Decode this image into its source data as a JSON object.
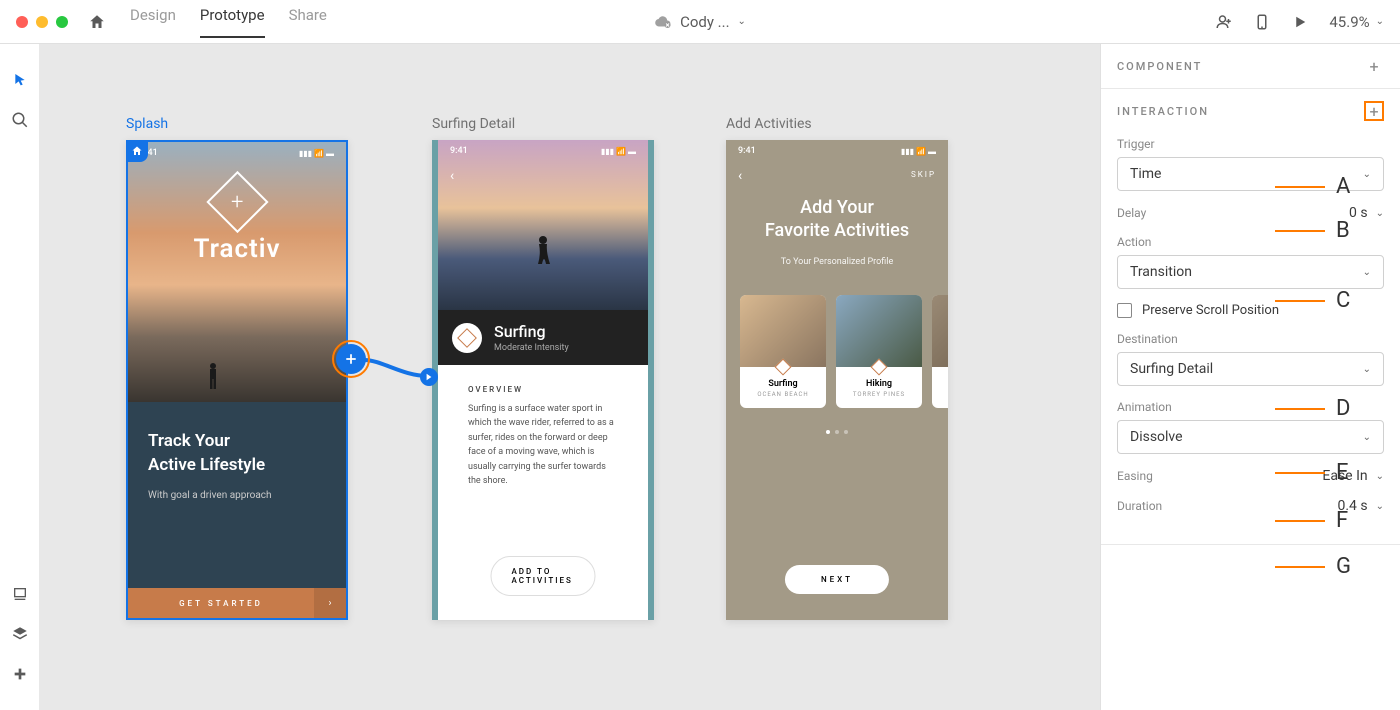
{
  "topbar": {
    "tabs": {
      "design": "Design",
      "prototype": "Prototype",
      "share": "Share"
    },
    "doc_name": "Cody ...",
    "zoom": "45.9%"
  },
  "canvas": {
    "artboard1": {
      "label": "Splash",
      "time": "9:41",
      "brand": "Tractiv",
      "headline": "Track Your\nActive Lifestyle",
      "sub": "With goal a driven approach",
      "cta": "GET STARTED"
    },
    "artboard2": {
      "label": "Surfing Detail",
      "time": "9:41",
      "title": "Surfing",
      "intensity": "Moderate Intensity",
      "overview_label": "OVERVIEW",
      "overview_text": "Surfing is a surface water sport in which the wave rider, referred to as a surfer, rides on the forward or deep face of a moving wave, which is usually carrying the surfer towards the shore.",
      "cta": "ADD TO ACTIVITIES"
    },
    "artboard3": {
      "label": "Add Activities",
      "time": "9:41",
      "skip": "SKIP",
      "headline": "Add Your\nFavorite Activities",
      "sub": "To Your Personalized Profile",
      "cards": {
        "c1_title": "Surfing",
        "c1_sub": "OCEAN BEACH",
        "c2_title": "Hiking",
        "c2_sub": "TORREY PINES"
      },
      "next": "NEXT"
    }
  },
  "panel": {
    "component_title": "COMPONENT",
    "interaction_title": "INTERACTION",
    "trigger_label": "Trigger",
    "trigger_value": "Time",
    "delay_label": "Delay",
    "delay_value": "0 s",
    "action_label": "Action",
    "action_value": "Transition",
    "preserve_label": "Preserve Scroll Position",
    "destination_label": "Destination",
    "destination_value": "Surfing Detail",
    "animation_label": "Animation",
    "animation_value": "Dissolve",
    "easing_label": "Easing",
    "easing_value": "Ease In",
    "duration_label": "Duration",
    "duration_value": "0.4 s"
  },
  "callouts": {
    "a": "A",
    "b": "B",
    "c": "C",
    "d": "D",
    "e": "E",
    "f": "F",
    "g": "G"
  }
}
